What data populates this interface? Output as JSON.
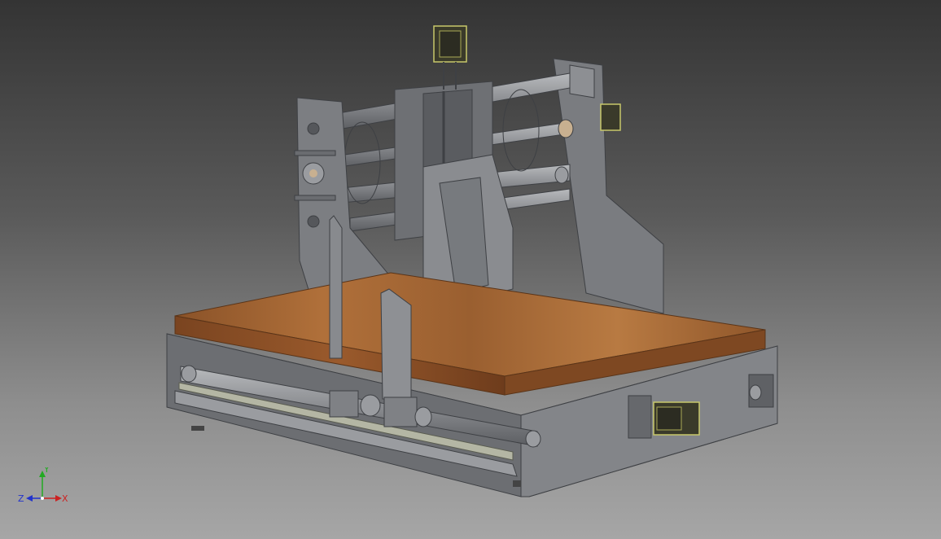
{
  "viewport": {
    "background_top": "#343434",
    "background_bottom": "#a6a6a6"
  },
  "model": {
    "frame_color": "#7c7e82",
    "frame_dark": "#55575b",
    "table_color": "#a0622e",
    "motor_color": "#c8c86a"
  },
  "triad": {
    "x_label": "X",
    "y_label": "Y",
    "z_label": "Z",
    "x_color": "#cc2222",
    "y_color": "#22aa22",
    "z_color": "#2233cc"
  }
}
